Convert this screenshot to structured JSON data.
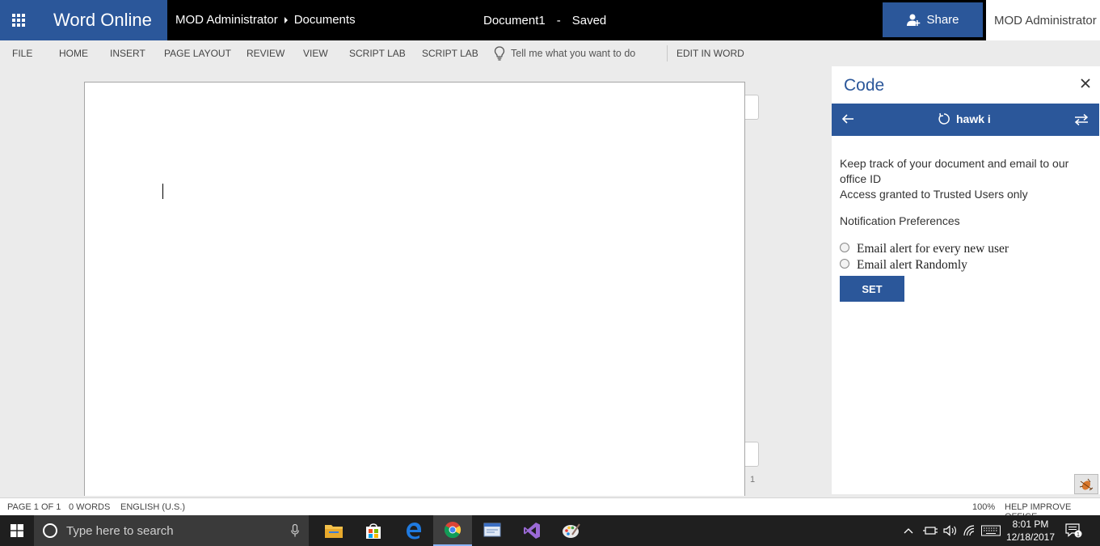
{
  "app": {
    "name": "Word Online",
    "brand_color": "#2b579a"
  },
  "header": {
    "breadcrumb": [
      "MOD Administrator",
      "Documents"
    ],
    "document_name": "Document1",
    "separator": "-",
    "save_status": "Saved",
    "share_label": "Share",
    "user_name": "MOD Administrator"
  },
  "ribbon": {
    "tabs": [
      "FILE",
      "HOME",
      "INSERT",
      "PAGE LAYOUT",
      "REVIEW",
      "VIEW",
      "SCRIPT LAB",
      "SCRIPT LAB"
    ],
    "tell_me_placeholder": "Tell me what you want to do",
    "edit_in_word": "EDIT IN WORD"
  },
  "document": {
    "page_number": "1"
  },
  "pane": {
    "title": "Code",
    "snippet_name": "hawk i",
    "description_line1": "Keep track of your document and email to our office ID",
    "description_line2": "Access granted to Trusted Users only",
    "preferences_label": "Notification Preferences",
    "options": [
      "Email alert for every new user",
      "Email alert Randomly"
    ],
    "set_button": "SET"
  },
  "status_bar": {
    "page": "PAGE 1 OF 1",
    "words": "0 WORDS",
    "language": "ENGLISH (U.S.)",
    "zoom": "100%",
    "help": "HELP IMPROVE OFFICE"
  },
  "taskbar": {
    "search_placeholder": "Type here to search",
    "apps": [
      "file-explorer-icon",
      "store-icon",
      "edge-icon",
      "chrome-icon",
      "app-icon",
      "visual-studio-icon",
      "paint-icon"
    ],
    "time": "8:01 PM",
    "date": "12/18/2017",
    "notification_count": "1"
  }
}
